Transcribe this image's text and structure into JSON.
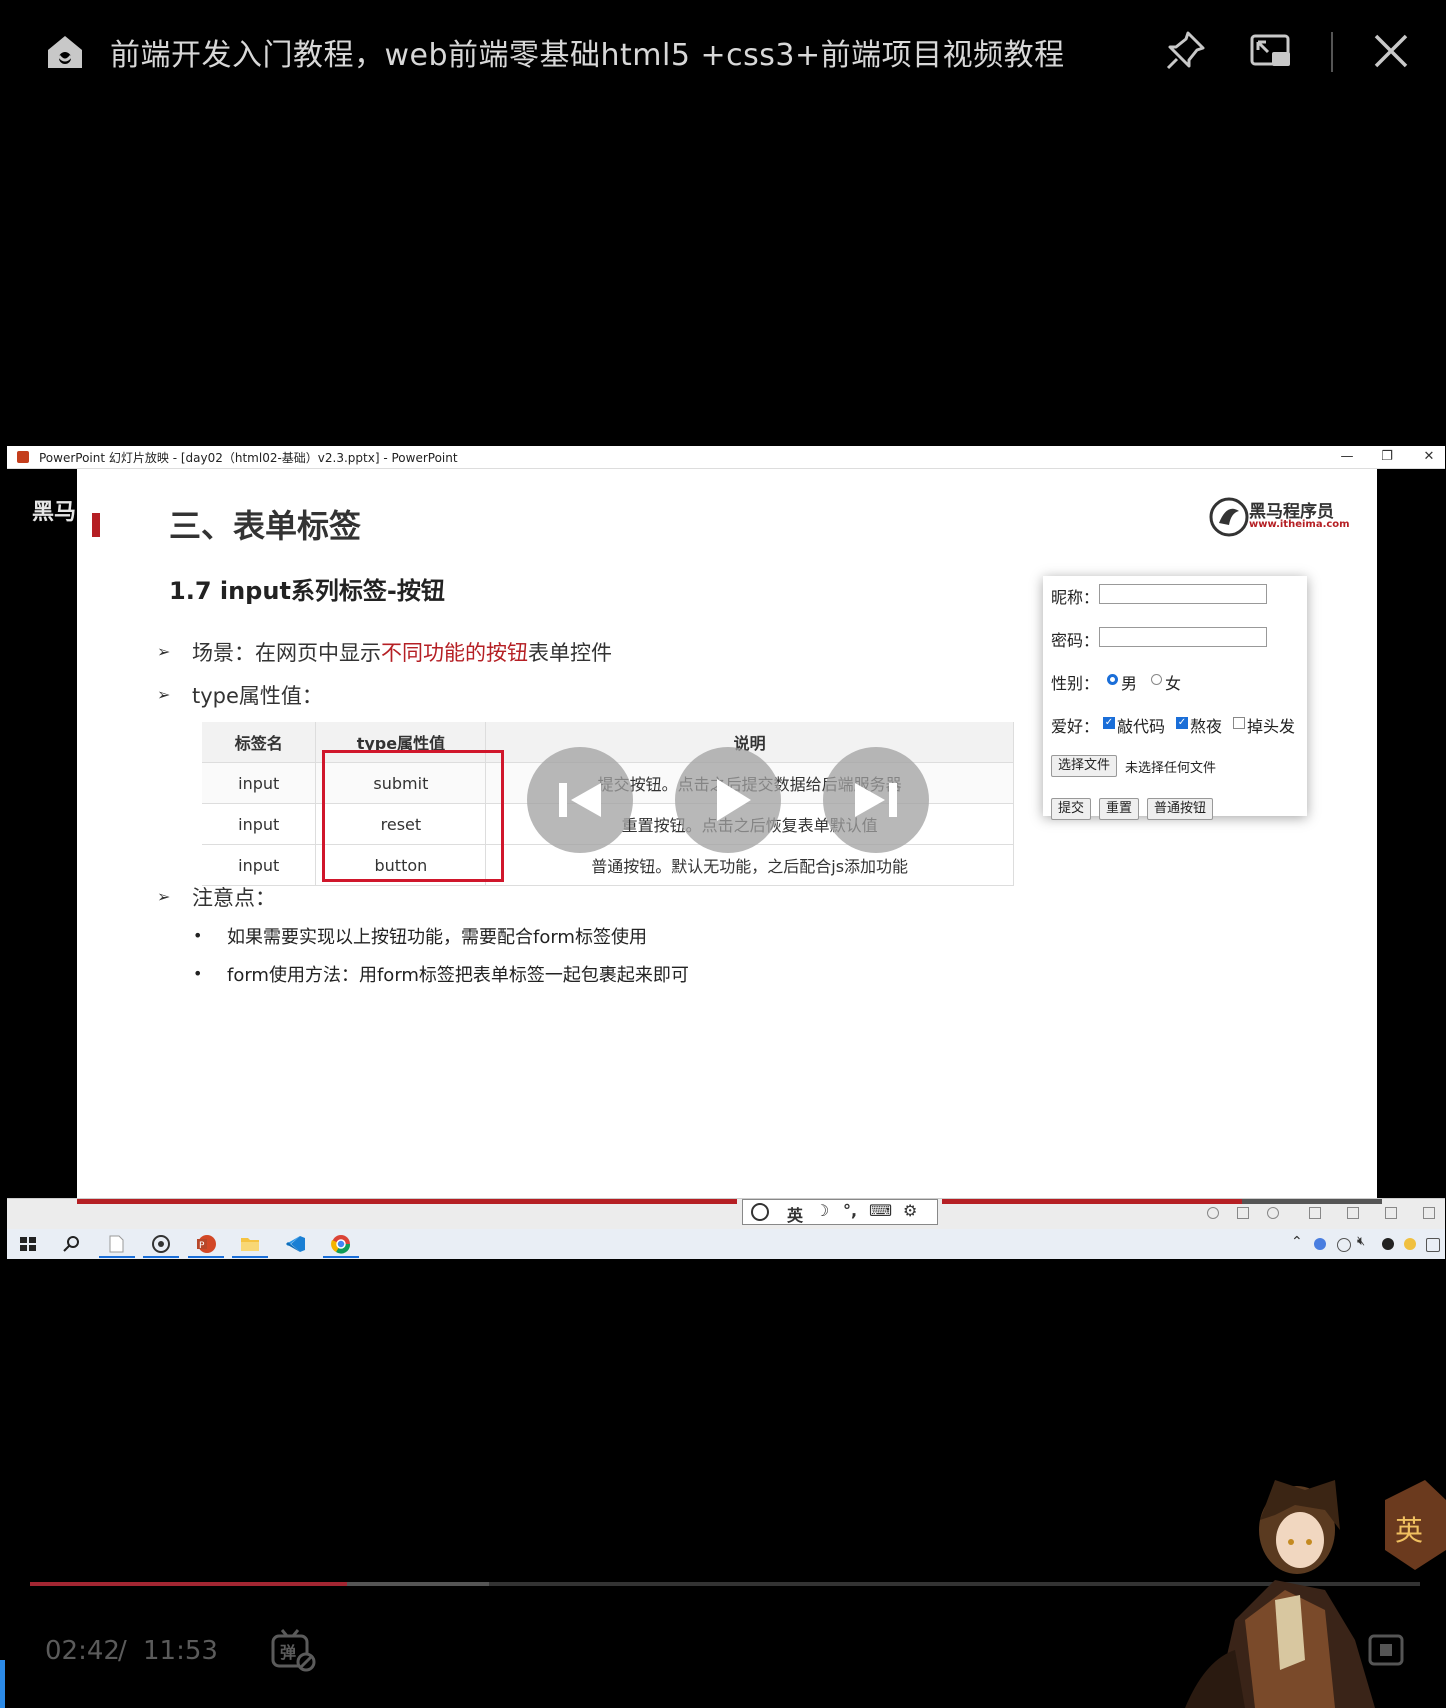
{
  "player": {
    "title": "前端开发入门教程，web前端零基础html5 +css3+前端项目视频教程",
    "time_current": "02:42",
    "time_separator": "/",
    "time_total": "11:53",
    "progress": 0.228,
    "buffered": 0.33,
    "icons": [
      "home-icon",
      "pin-icon",
      "picture-in-picture-icon",
      "close-icon",
      "previous-icon",
      "play-icon",
      "next-icon",
      "danmaku-icon",
      "fullscreen-icon"
    ]
  },
  "ppt_window": {
    "title": "PowerPoint 幻灯片放映 - [day02（html02-基础）v2.3.pptx] - PowerPoint",
    "minimize": "—",
    "restore": "❐",
    "close": "✕"
  },
  "watermark": "黑马",
  "slide": {
    "heading": "三、表单标签",
    "logo_name": "黑马程序员",
    "logo_url": "www.itheima.com",
    "subtitle": "1.7 input系列标签-按钮",
    "bullet1_prefix": "场景：在网页中显示",
    "bullet1_highlight": "不同功能的按钮",
    "bullet1_suffix": "表单控件",
    "bullet2": "type属性值：",
    "table": {
      "headers": [
        "标签名",
        "type属性值",
        "说明"
      ],
      "rows": [
        [
          "input",
          "submit",
          "提交按钮。点击之后提交数据给后端服务器"
        ],
        [
          "input",
          "reset",
          "重置按钮。点击之后恢复表单默认值"
        ],
        [
          "input",
          "button",
          "普通按钮。默认无功能，之后配合js添加功能"
        ]
      ]
    },
    "notes_title": "注意点：",
    "notes": [
      "如果需要实现以上按钮功能，需要配合form标签使用",
      "form使用方法：用form标签把表单标签一起包裹起来即可"
    ]
  },
  "demo_form": {
    "nickname_label": "昵称：",
    "password_label": "密码：",
    "gender_label": "性别：",
    "gender_options": [
      "男",
      "女"
    ],
    "gender_selected": "男",
    "hobby_label": "爱好：",
    "hobbies": [
      "敲代码",
      "熬夜",
      "掉头发"
    ],
    "hobbies_checked": [
      "敲代码",
      "熬夜"
    ],
    "file_button": "选择文件",
    "file_status": "未选择任何文件",
    "submit_button": "提交",
    "reset_button": "重置",
    "normal_button": "普通按钮"
  },
  "ime": {
    "mode": "英",
    "icons": [
      "ime-logo-icon",
      "moon-icon",
      "punctuation-icon",
      "keyboard-icon",
      "gear-icon"
    ]
  },
  "colors": {
    "accent_red": "#b51f24",
    "box_red": "#d0162b",
    "progress_red": "#a32632",
    "selection_blue": "#1a6ed8"
  }
}
